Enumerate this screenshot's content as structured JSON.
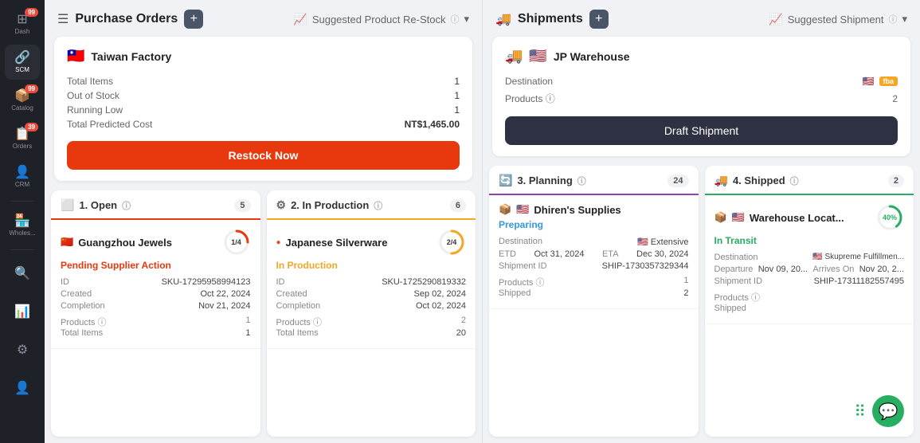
{
  "sidebar": {
    "items": [
      {
        "id": "dash",
        "label": "Dash",
        "icon": "⊞",
        "badge": "99",
        "active": false
      },
      {
        "id": "scm",
        "label": "SCM",
        "icon": "🔗",
        "badge": null,
        "active": true
      },
      {
        "id": "catalog",
        "label": "Catalog",
        "icon": "📦",
        "badge": "99",
        "active": false
      },
      {
        "id": "orders",
        "label": "Orders",
        "icon": "📋",
        "badge": "39",
        "active": false
      },
      {
        "id": "crm",
        "label": "CRM",
        "icon": "👤",
        "badge": null,
        "active": false
      },
      {
        "id": "wholesale",
        "label": "Wholes...",
        "icon": "🏪",
        "badge": null,
        "active": false
      },
      {
        "id": "search",
        "label": "",
        "icon": "🔍",
        "badge": null,
        "active": false
      },
      {
        "id": "reports",
        "label": "",
        "icon": "📊",
        "badge": null,
        "active": false
      },
      {
        "id": "settings",
        "label": "",
        "icon": "⚙",
        "badge": null,
        "active": false
      },
      {
        "id": "user",
        "label": "",
        "icon": "👤",
        "badge": null,
        "active": false
      }
    ]
  },
  "purchase_orders": {
    "section_title": "Purchase Orders",
    "add_btn_label": "+",
    "suggested_label": "Suggested Product Re-Stock",
    "card": {
      "factory_flag": "🇹🇼",
      "factory_name": "Taiwan Factory",
      "total_items_label": "Total Items",
      "total_items_value": "1",
      "out_of_stock_label": "Out of Stock",
      "out_of_stock_value": "1",
      "running_low_label": "Running Low",
      "running_low_value": "1",
      "total_cost_label": "Total Predicted Cost",
      "total_cost_value": "NT$1,465.00",
      "restock_btn_label": "Restock Now"
    }
  },
  "shipments": {
    "section_title": "Shipments",
    "add_btn_label": "+",
    "suggested_label": "Suggested Shipment",
    "card": {
      "ship_icon": "🚚",
      "warehouse_flag": "🇺🇸",
      "warehouse_name": "JP Warehouse",
      "destination_label": "Destination",
      "destination_flag": "🇺🇸",
      "fba_badge": "fba",
      "products_label": "Products",
      "products_info_icon": "ℹ",
      "products_value": "2",
      "draft_btn_label": "Draft Shipment"
    }
  },
  "kanban": {
    "columns": [
      {
        "id": "open",
        "title": "1. Open",
        "icon": "⬜",
        "color_class": "open",
        "count": "5",
        "card": {
          "flag": "🇨🇳",
          "supplier": "Guangzhou Jewels",
          "progress": "1/4",
          "progress_pct": 25,
          "status": "Pending Supplier Action",
          "status_class": "orange",
          "id_label": "ID",
          "id_value": "SKU-17295958994123",
          "created_label": "Created",
          "created_value": "Oct 22, 2024",
          "completion_label": "Completion",
          "completion_value": "Nov 21, 2024",
          "products_label": "Products",
          "products_info": "ℹ",
          "products_value": "1",
          "total_items_label": "Total Items",
          "total_items_value": "1"
        }
      },
      {
        "id": "production",
        "title": "2. In Production",
        "icon": "⚙",
        "color_class": "production",
        "count": "6",
        "card": {
          "flag": "🔴",
          "supplier": "Japanese Silverware",
          "progress": "2/4",
          "progress_pct": 50,
          "status": "In Production",
          "status_class": "yellow",
          "id_label": "ID",
          "id_value": "SKU-1725290819332",
          "created_label": "Created",
          "created_value": "Sep 02, 2024",
          "completion_label": "Completion",
          "completion_value": "Oct 02, 2024",
          "products_label": "Products",
          "products_info": "ℹ",
          "products_value": "2",
          "total_items_label": "Total Items",
          "total_items_value": "20"
        }
      },
      {
        "id": "planning",
        "title": "3. Planning",
        "icon": "🔄",
        "color_class": "planning",
        "count": "24",
        "card": {
          "flag": "📦",
          "flag2": "🇺🇸",
          "supplier": "Dhiren's Supplies",
          "status": "Preparing",
          "status_class": "blue",
          "destination_label": "Destination",
          "destination_flag": "🇺🇸",
          "destination_value": "Extensive",
          "etd_label": "ETD",
          "etd_value": "Oct 31, 2024",
          "eta_label": "ETA",
          "eta_value": "Dec 30, 2024",
          "shipment_id_label": "Shipment ID",
          "shipment_id_value": "SHIP-1730357329344",
          "products_label": "Products",
          "products_info": "ℹ",
          "products_value": "1",
          "shipped_label": "Shipped",
          "shipped_value": "2"
        }
      },
      {
        "id": "shipped",
        "title": "4. Shipped",
        "icon": "🚚",
        "color_class": "shipped",
        "count": "2",
        "card": {
          "flag": "📦",
          "flag2": "🇺🇸",
          "supplier": "Warehouse Locat...",
          "progress_pct": 40,
          "status": "In Transit",
          "status_class": "green",
          "destination_label": "Destination",
          "destination_flag": "🇺🇸",
          "destination_value": "Skupreme Fulfillmen...",
          "departure_label": "Departure",
          "departure_value": "Nov 09, 20...",
          "arrives_label": "Arrives On",
          "arrives_value": "Nov 20, 2...",
          "shipment_id_label": "Shipment ID",
          "shipment_id_value": "SHIP-17311182557495",
          "products_label": "Products",
          "products_info": "ℹ",
          "products_value": "",
          "shipped_label": "Shipped",
          "shipped_value": ""
        }
      }
    ]
  },
  "bottom_bar": {
    "grid_icon": "⠿",
    "chat_icon": "💬"
  }
}
